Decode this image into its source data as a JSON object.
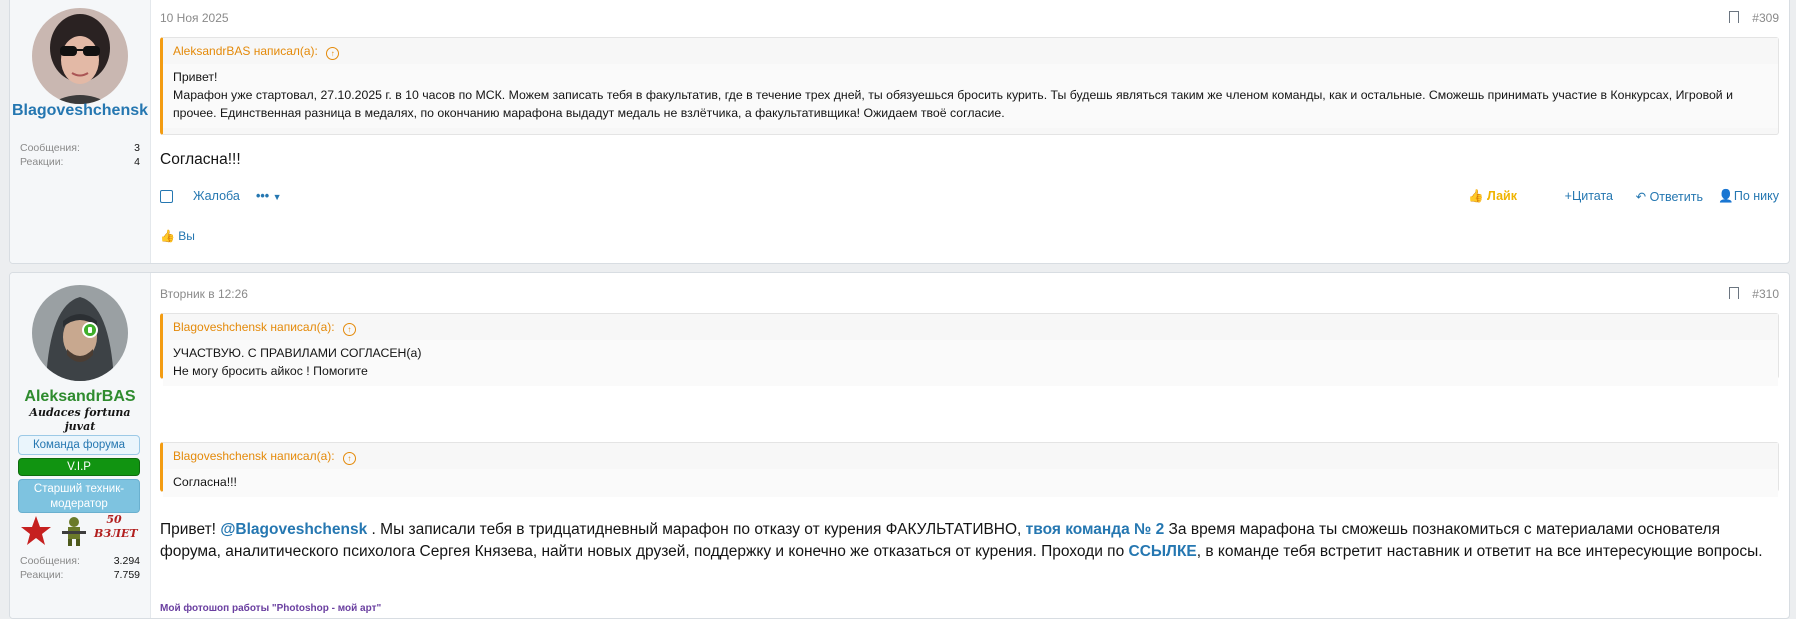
{
  "posts": [
    {
      "username": "Blagoveshchensk",
      "username_color": "#2577b1",
      "stats": [
        {
          "label": "Сообщения:",
          "value": "3"
        },
        {
          "label": "Реакции:",
          "value": "4"
        }
      ],
      "date": "10 Ноя 2025",
      "number": "#309",
      "quote": {
        "author": "AleksandrBAS написал(а):",
        "lines": [
          "Привет!",
          "Марафон уже стартовал, 27.10.2025 г. в 10 часов по МСК. Можем записать тебя в факультатив, где в течение трех дней, ты обязуешься бросить курить. Ты будешь являться таким же членом команды, как и остальные. Сможешь принимать участие в Конкурсах, Игровой и прочее. Единственная разница в медалях, по окончанию марафона выдадут медаль не взлётчика, а факультативщика! Ожидаем твоё согласие."
        ]
      },
      "message": "Согласна!!!",
      "actions": {
        "report": "Жалоба",
        "more": "•••",
        "like": "Лайк",
        "quote": "Цитата",
        "reply": "Ответить",
        "by_nick": "По нику"
      },
      "reactions_text": "Вы"
    },
    {
      "username": "AleksandrBAS",
      "username_color": "#2e8b2e",
      "user_title": "Audaces fortuna juvat",
      "badges": [
        "Команда форума",
        "V.I.P",
        "Старший техник-модератор"
      ],
      "trophy_label": "50 ВЗЛЕТ",
      "stats": [
        {
          "label": "Сообщения:",
          "value": "3.294"
        },
        {
          "label": "Реакции:",
          "value": "7.759"
        }
      ],
      "date": "Вторник в 12:26",
      "number": "#310",
      "quotes": [
        {
          "author": "Blagoveshchensk написал(а):",
          "lines": [
            "УЧАСТВУЮ. С ПРАВИЛАМИ СОГЛАСЕН(а)",
            "Не могу бросить айкос ! Помогите"
          ]
        },
        {
          "author": "Blagoveshchensk написал(а):",
          "lines": [
            "Согласна!!!"
          ]
        }
      ],
      "message_parts": {
        "p1": "Привет! ",
        "mention": "@Blagoveshchensk",
        "p2": " . Мы записали тебя в тридцатидневный марафон по отказу от курения ФАКУЛЬТАТИВНО, ",
        "team": "твоя команда № 2",
        "p3": " За время марафона ты сможешь познакомиться с материалами основателя форума, аналитического психолога Сергея Князева, найти новых друзей, поддержку и конечно же отказаться от курения. Проходи по ",
        "link": "ССЫЛКЕ",
        "p4": ", в команде тебя встретит наставник и ответит на все интересующие вопросы."
      },
      "signature": "Мой фотошоп работы \"Photoshop - мой арт\""
    }
  ]
}
